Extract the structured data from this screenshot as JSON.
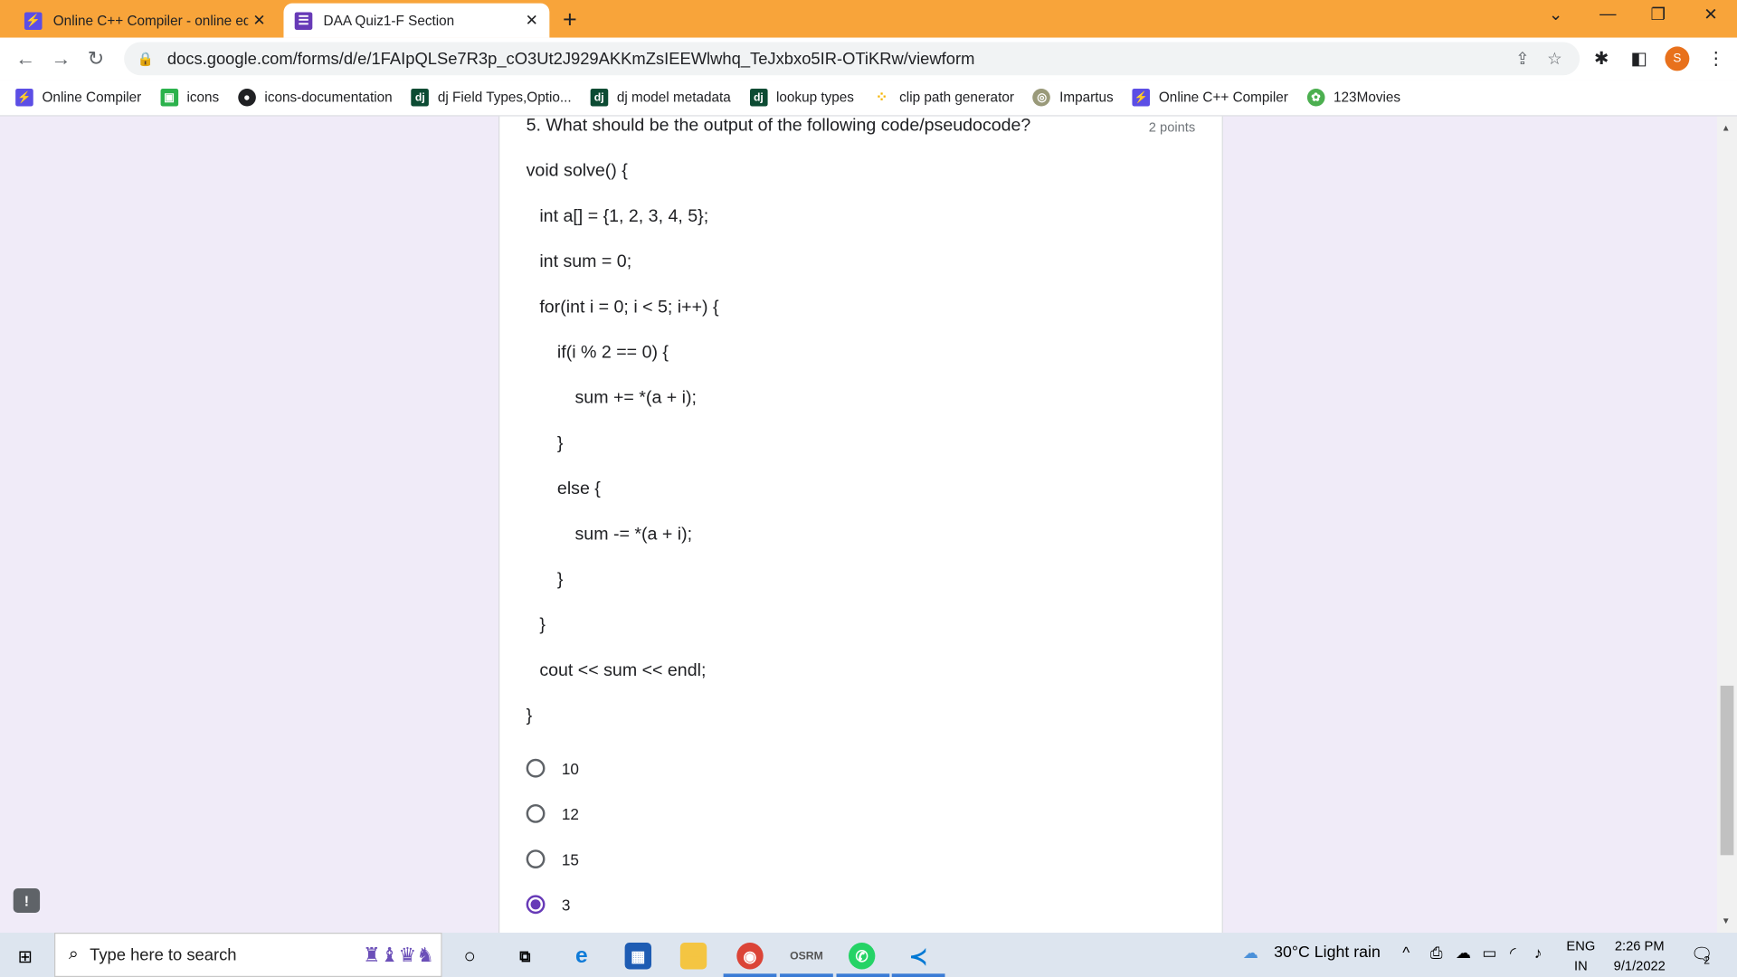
{
  "browser": {
    "tabs": [
      {
        "title": "Online C++ Compiler - online ed",
        "active": false
      },
      {
        "title": "DAA Quiz1-F Section",
        "active": true
      }
    ],
    "new_tab_label": "+",
    "url": "docs.google.com/forms/d/e/1FAIpQLSe7R3p_cO3Ut2J929AKKmZsIEEWlwhq_TeJxbxo5IR-OTiKRw/viewform",
    "profile_initial": "S",
    "bookmarks": [
      {
        "label": "Online Compiler",
        "icon": "bolt-icon",
        "color": "#5c4ee5"
      },
      {
        "label": "icons",
        "icon": "icons-icon",
        "color": "#2bb24c"
      },
      {
        "label": "icons-documentation",
        "icon": "globe-icon",
        "color": "#202124"
      },
      {
        "label": "dj Field Types,Optio...",
        "icon": "dj-icon",
        "color": "#0c4b33"
      },
      {
        "label": "dj model metadata",
        "icon": "dj-icon",
        "color": "#0c4b33"
      },
      {
        "label": "lookup types",
        "icon": "dj-icon",
        "color": "#0c4b33"
      },
      {
        "label": "clip path generator",
        "icon": "dots-icon",
        "color": "#f5b400"
      },
      {
        "label": "Impartus",
        "icon": "impartus-icon",
        "color": "#9a9a7a"
      },
      {
        "label": "Online C++ Compiler",
        "icon": "bolt-icon",
        "color": "#5c4ee5"
      },
      {
        "label": "123Movies",
        "icon": "film-icon",
        "color": "#4caf50"
      }
    ]
  },
  "question": {
    "title": "5. What should be the output of the following code/pseudocode?",
    "points": "2 points",
    "code": [
      "void solve() {",
      "int a[] = {1, 2, 3, 4, 5};",
      "int sum = 0;",
      "for(int i = 0; i < 5; i++) {",
      "if(i % 2 == 0) {",
      "sum += *(a + i);",
      "}",
      "else {",
      "sum -= *(a + i);",
      "}",
      "}",
      "cout << sum << endl;",
      "}"
    ],
    "options": [
      {
        "label": "10",
        "selected": false
      },
      {
        "label": "12",
        "selected": false
      },
      {
        "label": "15",
        "selected": false
      },
      {
        "label": "3",
        "selected": true
      }
    ]
  },
  "taskbar": {
    "search_placeholder": "Type here to search",
    "weather": "30°C  Light rain",
    "lang_top": "ENG",
    "lang_bottom": "IN",
    "time": "2:26 PM",
    "date": "9/1/2022",
    "notification_count": "2"
  },
  "colors": {
    "tabstrip": "#f8a43a",
    "form_bg": "#f0ebf8",
    "radio_selected": "#673ab7"
  }
}
